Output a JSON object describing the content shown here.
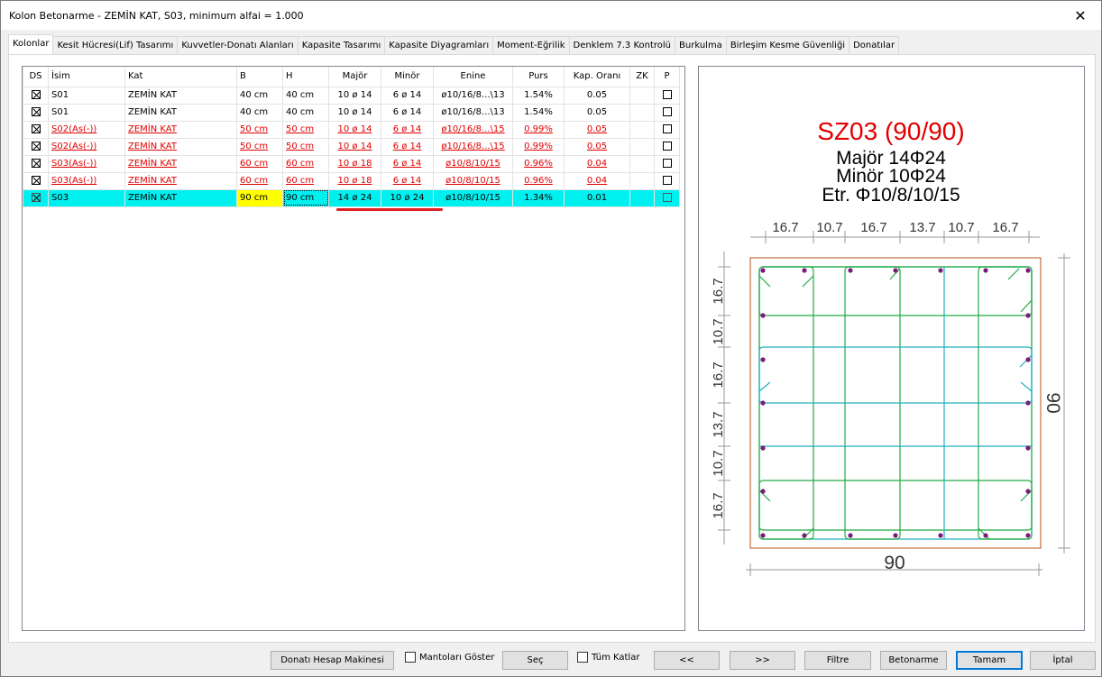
{
  "window": {
    "title": "Kolon Betonarme - ZEMİN KAT, S03, minimum alfai = 1.000",
    "close": "✕"
  },
  "tabs": [
    "Kolonlar",
    "Kesit Hücresi(Lif) Tasarımı",
    "Kuvvetler-Donatı Alanları",
    "Kapasite Tasarımı",
    "Kapasite Diyagramları",
    "Moment-Eğrilik",
    "Denklem 7.3 Kontrolü",
    "Burkulma",
    "Birleşim Kesme Güvenliği",
    "Donatılar"
  ],
  "grid": {
    "headers": [
      "DS",
      "İsim",
      "Kat",
      "B",
      "H",
      "Majör",
      "Minör",
      "Enine",
      "Purs",
      "Kap. Oranı",
      "ZK",
      "P"
    ],
    "rows": [
      {
        "isim": "S01",
        "kat": "ZEMİN KAT",
        "b": "40 cm",
        "h": "40 cm",
        "major": "10 ø 14",
        "minor": "6 ø 14",
        "enine": "ø10/16/8...\\13",
        "purs": "1.54%",
        "kap": "0.05",
        "style": "normal"
      },
      {
        "isim": "S01",
        "kat": "ZEMİN KAT",
        "b": "40 cm",
        "h": "40 cm",
        "major": "10 ø 14",
        "minor": "6 ø 14",
        "enine": "ø10/16/8...\\13",
        "purs": "1.54%",
        "kap": "0.05",
        "style": "normal"
      },
      {
        "isim": "S02(As(-))",
        "kat": "ZEMİN KAT",
        "b": "50 cm",
        "h": "50 cm",
        "major": "10 ø 14",
        "minor": "6 ø 14",
        "enine": "ø10/16/8...\\15",
        "purs": "0.99%",
        "kap": "0.05",
        "style": "red"
      },
      {
        "isim": "S02(As(-))",
        "kat": "ZEMİN KAT",
        "b": "50 cm",
        "h": "50 cm",
        "major": "10 ø 14",
        "minor": "6 ø 14",
        "enine": "ø10/16/8...\\15",
        "purs": "0.99%",
        "kap": "0.05",
        "style": "red"
      },
      {
        "isim": "S03(As(-))",
        "kat": "ZEMİN KAT",
        "b": "60 cm",
        "h": "60 cm",
        "major": "10 ø 18",
        "minor": "6 ø 14",
        "enine": "ø10/8/10/15",
        "purs": "0.96%",
        "kap": "0.04",
        "style": "red"
      },
      {
        "isim": "S03(As(-))",
        "kat": "ZEMİN KAT",
        "b": "60 cm",
        "h": "60 cm",
        "major": "10 ø 18",
        "minor": "6 ø 14",
        "enine": "ø10/8/10/15",
        "purs": "0.96%",
        "kap": "0.04",
        "style": "red"
      },
      {
        "isim": "S03",
        "kat": "ZEMİN KAT",
        "b": "90 cm",
        "h": "90 cm",
        "major": "14 ø 24",
        "minor": "10 ø 24",
        "enine": "ø10/8/10/15",
        "purs": "1.34%",
        "kap": "0.01",
        "style": "selected"
      }
    ]
  },
  "drawing": {
    "title": "SZ03 (90/90)",
    "line1": "Majör 14Φ24",
    "line2": "Minör 10Φ24",
    "line3": "Etr. Φ10/8/10/15",
    "top_dims": [
      "16.7",
      "10.7",
      "16.7",
      "13.7",
      "10.7",
      "16.7"
    ],
    "left_dims": [
      "16.7",
      "10.7",
      "16.7",
      "13.7",
      "10.7",
      "16.7"
    ],
    "width_label": "90",
    "height_label": "90",
    "colors": {
      "title": "#e00000",
      "frame": "#c07040",
      "stirrup_green": "#22aa44",
      "stirrup_cyan": "#20b0c0",
      "bar": "#7a1a7a"
    }
  },
  "buttons": {
    "calc": "Donatı Hesap Makinesi",
    "mantolar": "Mantoları Göster",
    "sec": "Seç",
    "tum_katlar": "Tüm Katlar",
    "prev": "<<",
    "next": ">>",
    "filtre": "Filtre",
    "betonarme": "Betonarme",
    "tamam": "Tamam",
    "iptal": "İptal"
  }
}
